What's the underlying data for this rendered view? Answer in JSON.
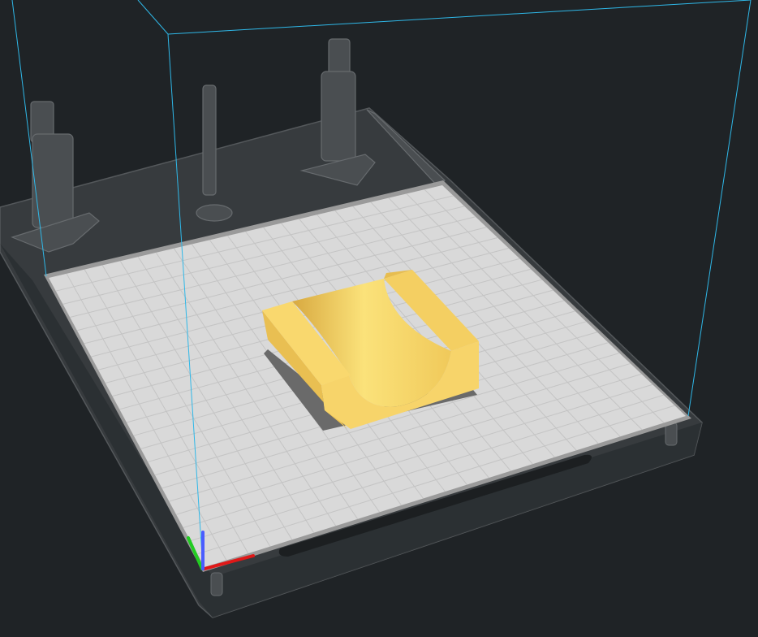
{
  "viewport": {
    "background_color": "#1f2326",
    "build_volume_line_color": "#2fb8e8",
    "build_plate_color": "#d9d9d9",
    "grid_line_color": "#c4c4c4",
    "model_color": "#f7d46a",
    "model_shade_color": "#e0b23c",
    "axis_x_color": "#e01818",
    "axis_y_color": "#22cc22",
    "axis_z_color": "#4a5cff",
    "grid_divisions": 22
  }
}
